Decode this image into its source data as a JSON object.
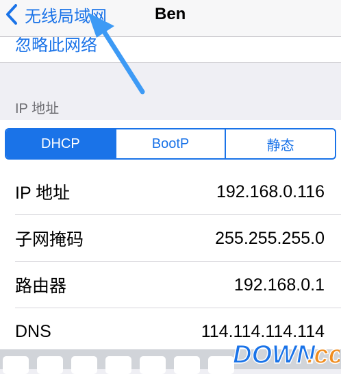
{
  "navbar": {
    "back_label": "无线局域网",
    "title": "Ben"
  },
  "partial_row": {
    "text": "忽略此网络"
  },
  "section": {
    "header": "IP 地址"
  },
  "segments": [
    {
      "label": "DHCP",
      "selected": true
    },
    {
      "label": "BootP",
      "selected": false
    },
    {
      "label": "静态",
      "selected": false
    }
  ],
  "rows": [
    {
      "label": "IP 地址",
      "value": "192.168.0.116"
    },
    {
      "label": "子网掩码",
      "value": "255.255.255.0"
    },
    {
      "label": "路由器",
      "value": "192.168.0.1"
    },
    {
      "label": "DNS",
      "value": "114.114.114.114"
    }
  ],
  "watermark": {
    "text": "DOWN.cc"
  },
  "colors": {
    "accent": "#1a73e8",
    "annotation_arrow": "#3d9af5",
    "background": "#efeff4"
  },
  "icons": {
    "back": "chevron-left-icon"
  }
}
